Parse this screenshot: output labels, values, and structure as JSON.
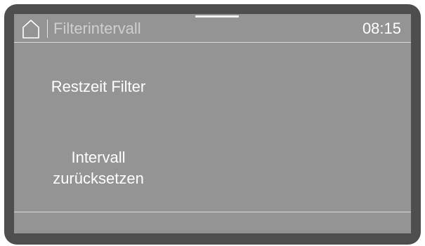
{
  "header": {
    "title": "Filterintervall",
    "time": "08:15",
    "home_icon": "home-icon"
  },
  "menu": {
    "items": [
      {
        "lines": [
          "Restzeit Filter"
        ]
      },
      {
        "lines": [
          "Intervall",
          "zurücksetzen"
        ]
      }
    ]
  },
  "colors": {
    "screen": "#949494",
    "bezel": "#4e4e4e",
    "text": "#ffffff",
    "title_text": "#cfcfcf"
  }
}
